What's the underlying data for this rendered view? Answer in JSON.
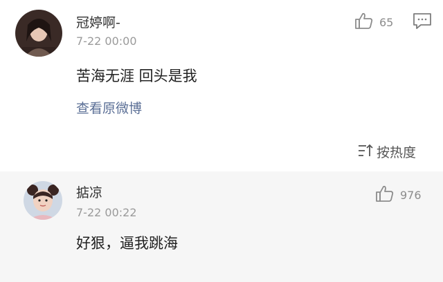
{
  "comment": {
    "user_name": "冠婷啊-",
    "timestamp": "7-22 00:00",
    "text": "苦海无涯 回头是我",
    "like_count": "65",
    "view_original_label": "查看原微博",
    "like_icon": "thumbs-up-icon",
    "comment_icon": "comment-bubble-icon"
  },
  "sort": {
    "label": "按热度",
    "icon": "sort-icon"
  },
  "reply": {
    "user_name": "掂凉",
    "timestamp": "7-22 00:22",
    "text": "好狠，逼我跳海",
    "like_count": "976",
    "like_icon": "thumbs-up-icon"
  },
  "colors": {
    "link": "#5b6f96",
    "timestamp": "#9a9a9a",
    "reply_background": "#f6f6f6"
  }
}
